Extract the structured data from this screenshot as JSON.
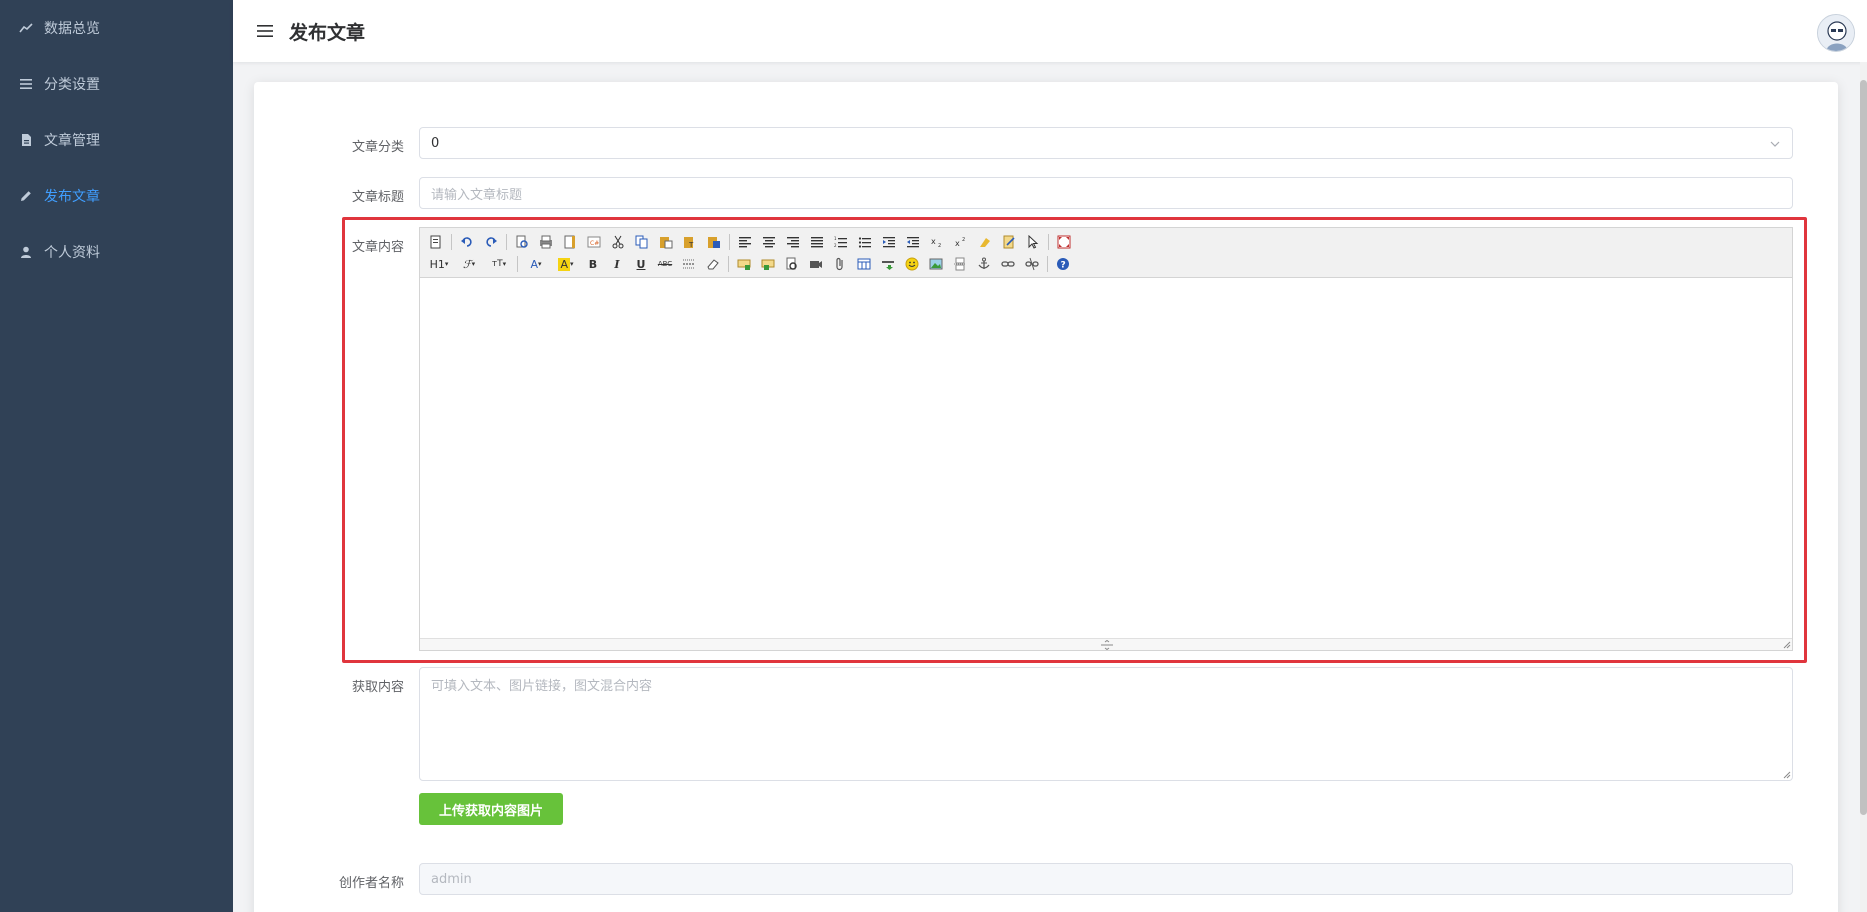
{
  "sidebar": {
    "items": [
      {
        "label": "数据总览",
        "icon": "trend-chart-icon",
        "active": false
      },
      {
        "label": "分类设置",
        "icon": "menu-lines-icon",
        "active": false
      },
      {
        "label": "文章管理",
        "icon": "document-icon",
        "active": false
      },
      {
        "label": "发布文章",
        "icon": "edit-pen-icon",
        "active": true
      },
      {
        "label": "个人资料",
        "icon": "user-icon",
        "active": false
      }
    ]
  },
  "header": {
    "title": "发布文章"
  },
  "form": {
    "category": {
      "label": "文章分类",
      "value": "0"
    },
    "title": {
      "label": "文章标题",
      "placeholder": "请输入文章标题"
    },
    "content": {
      "label": "文章内容"
    },
    "fetch": {
      "label": "获取内容",
      "placeholder": "可填入文本、图片链接，图文混合内容"
    },
    "upload_button": "上传获取内容图片",
    "author": {
      "label": "创作者名称",
      "value": "admin"
    }
  },
  "editor": {
    "row2_text_buttons": {
      "heading": "H1",
      "bold": "B",
      "italic": "I",
      "underline": "U",
      "strike": "ABC"
    }
  },
  "colors": {
    "sidebar_bg": "#304156",
    "active_menu": "#409eff",
    "highlight": "#e0353d",
    "upload_button": "#67c23a"
  }
}
